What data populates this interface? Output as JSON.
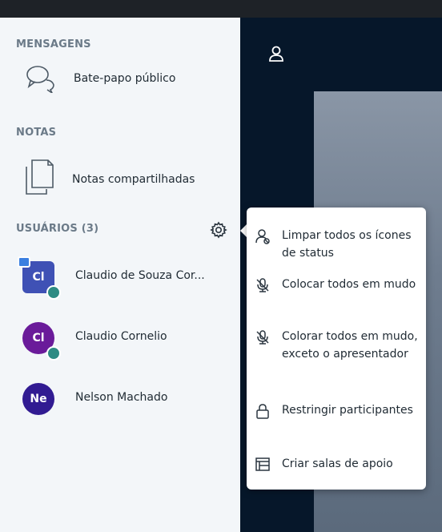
{
  "sidebar": {
    "messages_title": "MENSAGENS",
    "public_chat_label": "Bate-papo público",
    "notes_title": "NOTAS",
    "shared_notes_label": "Notas compartilhadas",
    "users_title": "USUÁRIOS (3)",
    "users": [
      {
        "initials": "Cl",
        "name": "Claudio de Souza Cor...",
        "color": "#3f51b5",
        "shape": "square",
        "presenter": true,
        "status_badge": true
      },
      {
        "initials": "Cl",
        "name": "Claudio Cornelio",
        "color": "#6a1b9a",
        "shape": "round",
        "presenter": false,
        "status_badge": true
      },
      {
        "initials": "Ne",
        "name": "Nelson Machado",
        "color": "#311b92",
        "shape": "round",
        "presenter": false,
        "status_badge": false
      }
    ]
  },
  "menu": {
    "items": [
      {
        "label": "Limpar todos os ícones de status",
        "icon": "clear-status-icon"
      },
      {
        "label": "Colocar todos em mudo",
        "icon": "mute-icon"
      },
      {
        "label": "Colorar todos em mudo, exceto o apresentador",
        "icon": "mute-icon"
      },
      {
        "label": "Restringir participantes",
        "icon": "lock-icon"
      },
      {
        "label": "Criar salas de apoio",
        "icon": "breakout-rooms-icon"
      }
    ]
  },
  "colors": {
    "sidebar_bg": "#f3f6f9",
    "main_bg": "#06172a",
    "status_badge": "#2e8b83",
    "presenter_badge": "#3b7fe0"
  }
}
